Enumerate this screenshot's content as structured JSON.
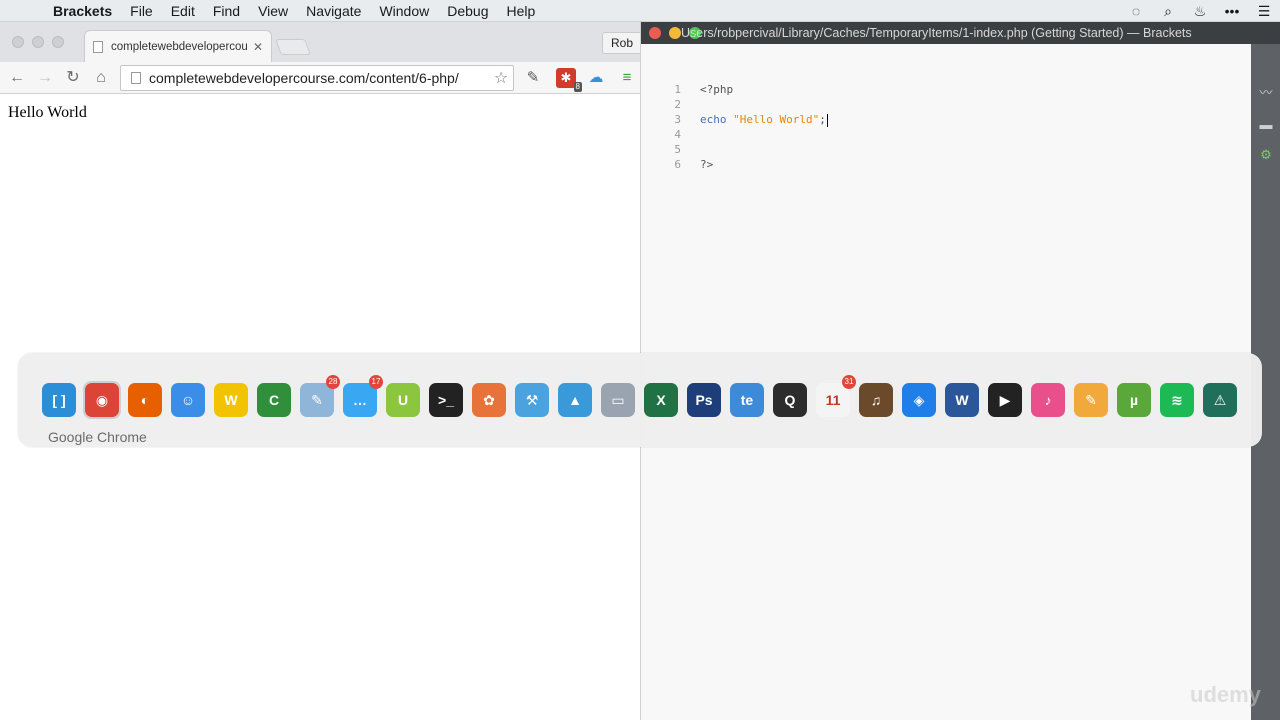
{
  "menubar": {
    "app_name": "Brackets",
    "items": [
      "File",
      "Edit",
      "Find",
      "View",
      "Navigate",
      "Window",
      "Debug",
      "Help"
    ]
  },
  "chrome": {
    "tab_title": "completewebdevelopercou",
    "profile_name": "Rob",
    "url": "completewebdevelopercourse.com/content/6-php/",
    "page_text": "Hello World",
    "extension_badge": "8"
  },
  "brackets": {
    "window_title": "Users/robpercival/Library/Caches/TemporaryItems/1-index.php (Getting Started) — Brackets",
    "lines": [
      {
        "n": "1",
        "code": "<?php"
      },
      {
        "n": "2",
        "code": ""
      },
      {
        "n": "3",
        "kw": "echo",
        "str": "\"Hello World\"",
        "end": ";"
      },
      {
        "n": "4",
        "code": ""
      },
      {
        "n": "5",
        "code": ""
      },
      {
        "n": "6",
        "code": "?>"
      }
    ]
  },
  "dock": {
    "selected_label": "Google Chrome",
    "apps": [
      {
        "name": "brackets-icon",
        "glyph": "[ ]",
        "color": "#2b8ed6"
      },
      {
        "name": "chrome-icon",
        "glyph": "◉",
        "color": "#db4437"
      },
      {
        "name": "firefox-icon",
        "glyph": "◐",
        "color": "#e66000"
      },
      {
        "name": "finder-icon",
        "glyph": "☺",
        "color": "#3b8ee8"
      },
      {
        "name": "cyberduck-icon",
        "glyph": "W",
        "color": "#f2c300"
      },
      {
        "name": "camtasia-icon",
        "glyph": "C",
        "color": "#2f8f3a"
      },
      {
        "name": "preview-icon",
        "glyph": "✎",
        "color": "#8fb6d8",
        "badge": "28"
      },
      {
        "name": "messages-icon",
        "glyph": "…",
        "color": "#39a7f2",
        "badge": "17"
      },
      {
        "name": "udemy-icon",
        "glyph": "U",
        "color": "#8cc63f"
      },
      {
        "name": "terminal-icon",
        "glyph": ">_",
        "color": "#222222"
      },
      {
        "name": "dvd-player-icon",
        "glyph": "✿",
        "color": "#e8733a"
      },
      {
        "name": "xcode-icon",
        "glyph": "⚒",
        "color": "#4aa3df"
      },
      {
        "name": "xcode-alt-icon",
        "glyph": "▲",
        "color": "#3a9ad9"
      },
      {
        "name": "preview-file-icon",
        "glyph": "▭",
        "color": "#9aa4b0"
      },
      {
        "name": "excel-icon",
        "glyph": "X",
        "color": "#207245"
      },
      {
        "name": "photoshop-icon",
        "glyph": "Ps",
        "color": "#1d3e78"
      },
      {
        "name": "textexpander-icon",
        "glyph": "te",
        "color": "#3c8ad8"
      },
      {
        "name": "quicktime-icon",
        "glyph": "Q",
        "color": "#2c2c2c"
      },
      {
        "name": "calendar-icon",
        "glyph": "11",
        "color": "#f4f4f4",
        "badge": "31"
      },
      {
        "name": "garageband-icon",
        "glyph": "♫",
        "color": "#6b4a2c"
      },
      {
        "name": "safari-icon",
        "glyph": "◈",
        "color": "#1f7ee8"
      },
      {
        "name": "word-icon",
        "glyph": "W",
        "color": "#2b579a"
      },
      {
        "name": "infuse-icon",
        "glyph": "▶",
        "color": "#222222"
      },
      {
        "name": "itunes-icon",
        "glyph": "♪",
        "color": "#e94f8b"
      },
      {
        "name": "pages-icon",
        "glyph": "✎",
        "color": "#f2a93b"
      },
      {
        "name": "utorrent-icon",
        "glyph": "µ",
        "color": "#5aa83a"
      },
      {
        "name": "spotify-icon",
        "glyph": "≋",
        "color": "#1db954"
      },
      {
        "name": "console-icon",
        "glyph": "⚠",
        "color": "#1f6f5a"
      }
    ]
  },
  "watermark": "udemy"
}
